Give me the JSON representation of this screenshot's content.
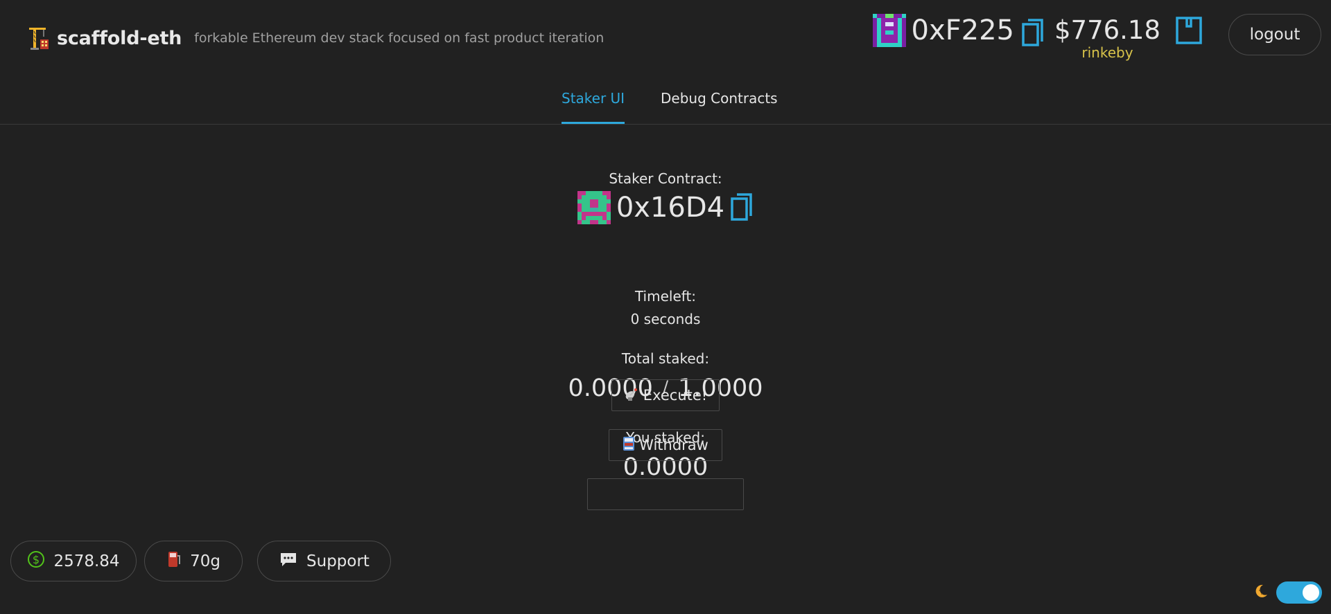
{
  "header": {
    "title": "scaffold-eth",
    "subtitle": "forkable Ethereum dev stack focused on fast product iteration"
  },
  "account": {
    "address": "0xF225",
    "balance": "$776.18",
    "network": "rinkeby",
    "logout_label": "logout"
  },
  "tabs": [
    {
      "label": "Staker UI",
      "active": true
    },
    {
      "label": "Debug Contracts",
      "active": false
    }
  ],
  "staker": {
    "contract_label": "Staker Contract:",
    "contract_address": "0x16D4",
    "timeleft_label": "Timeleft:",
    "timeleft_value": "0 seconds",
    "total_label": "Total staked:",
    "total_staked": "0.0000",
    "separator": "/",
    "threshold": "1.0000",
    "you_label": "You staked:",
    "you_staked": "0.0000",
    "execute_label": "Execute!",
    "withdraw_label": "Withdraw"
  },
  "footer": {
    "eth_price": "2578.84",
    "gas_price": "70g",
    "support_label": "Support"
  },
  "colors": {
    "background": "#212121",
    "accent": "#2ea8dc",
    "network": "#d8c34a",
    "price_icon": "#52c41a"
  },
  "icons": {
    "logo": "construction-crane-icon",
    "copy": "copy-icon",
    "wallet": "wallet-icon",
    "price": "dollar-circle-icon",
    "gas": "fuel-pump-icon",
    "support": "chat-bubble-icon",
    "execute": "satellite-icon",
    "withdraw": "atm-icon",
    "theme": "moon-icon"
  }
}
